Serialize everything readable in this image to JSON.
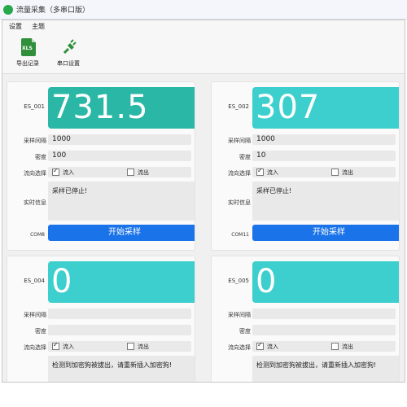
{
  "window": {
    "title": "流量采集（多串口版）"
  },
  "menu": {
    "settings": "设置",
    "theme": "主题"
  },
  "toolbar": {
    "export_label": "导出记录",
    "serial_label": "串口设置",
    "xls_text": "XLS"
  },
  "colors": {
    "panel1_display": "#2ab7a6",
    "panel_display": "#3ccfce",
    "button": "#1a73e8"
  },
  "panels": [
    {
      "id": "ES_001",
      "value": "731.5",
      "interval_label": "采样间隔",
      "interval": "1000",
      "density_label": "密度",
      "density": "100",
      "flow_label": "流向选择",
      "in_label": "流入",
      "out_label": "流出",
      "info_label": "实时信息",
      "info": "采样已停止!",
      "com": "COM8",
      "button": "开始采样"
    },
    {
      "id": "ES_002",
      "value": "307",
      "interval_label": "采样间隔",
      "interval": "1000",
      "density_label": "密度",
      "density": "10",
      "flow_label": "流向选择",
      "in_label": "流入",
      "out_label": "流出",
      "info_label": "实时信息",
      "info": "采样已停止!",
      "com": "COM11",
      "button": "开始采样"
    },
    {
      "id": "ES_004",
      "value": "0",
      "interval_label": "采样间隔",
      "density_label": "密度",
      "flow_label": "流向选择",
      "in_label": "流入",
      "out_label": "流出",
      "info": "检测到加密狗被拔出，请重新插入加密狗!"
    },
    {
      "id": "ES_005",
      "value": "0",
      "interval_label": "采样间隔",
      "density_label": "密度",
      "flow_label": "流向选择",
      "in_label": "流入",
      "out_label": "流出",
      "info": "检测到加密狗被拔出，请重新插入加密狗!"
    }
  ]
}
